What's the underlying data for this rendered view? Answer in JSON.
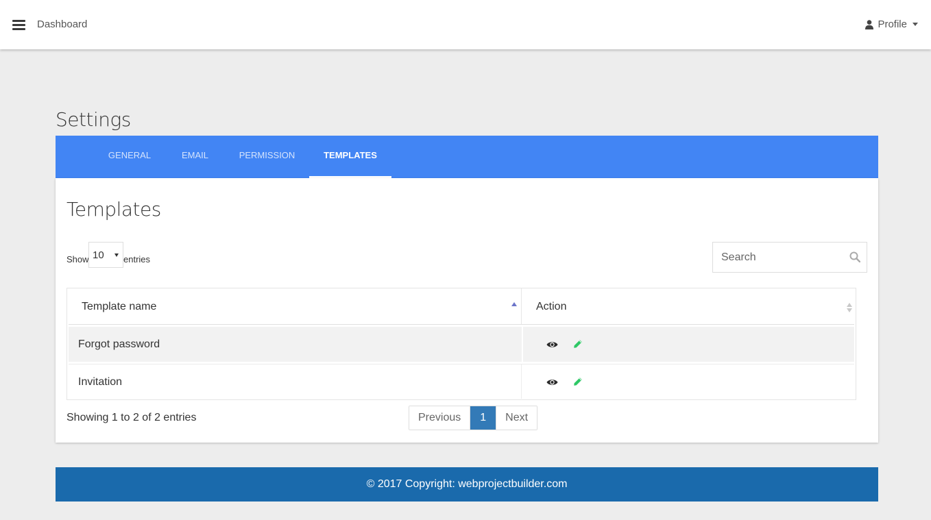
{
  "navbar": {
    "brand": "Dashboard",
    "profile_label": "Profile",
    "menu_icon": "hamburger-icon",
    "profile_icon": "user-icon"
  },
  "page": {
    "title": "Settings"
  },
  "tabs": [
    {
      "label": "GENERAL",
      "active": false
    },
    {
      "label": "EMAIL",
      "active": false
    },
    {
      "label": "PERMISSION",
      "active": false
    },
    {
      "label": "TEMPLATES",
      "active": true
    }
  ],
  "card": {
    "title": "Templates",
    "length": {
      "show_label": "Show",
      "value": "10",
      "entries_label": "entries"
    },
    "search": {
      "placeholder": "Search",
      "icon": "search-icon"
    },
    "table": {
      "columns": [
        "Template name",
        "Action"
      ],
      "rows": [
        {
          "name": "Forgot password",
          "actions": [
            "eye-icon",
            "pencil-icon"
          ]
        },
        {
          "name": "Invitation",
          "actions": [
            "eye-icon",
            "pencil-icon"
          ]
        }
      ]
    },
    "info": "Showing 1 to 2 of 2 entries",
    "pagination": {
      "previous": "Previous",
      "current": "1",
      "next": "Next"
    }
  },
  "footer": {
    "prefix": "© 2017 Copyright: ",
    "site": "webprojectbuilder.com"
  },
  "colors": {
    "tab_bar": "#4285f4",
    "footer": "#1a6aac",
    "pagination_active": "#337ab7",
    "edit_icon": "#2ec866",
    "sort_active": "#6b74c9"
  }
}
